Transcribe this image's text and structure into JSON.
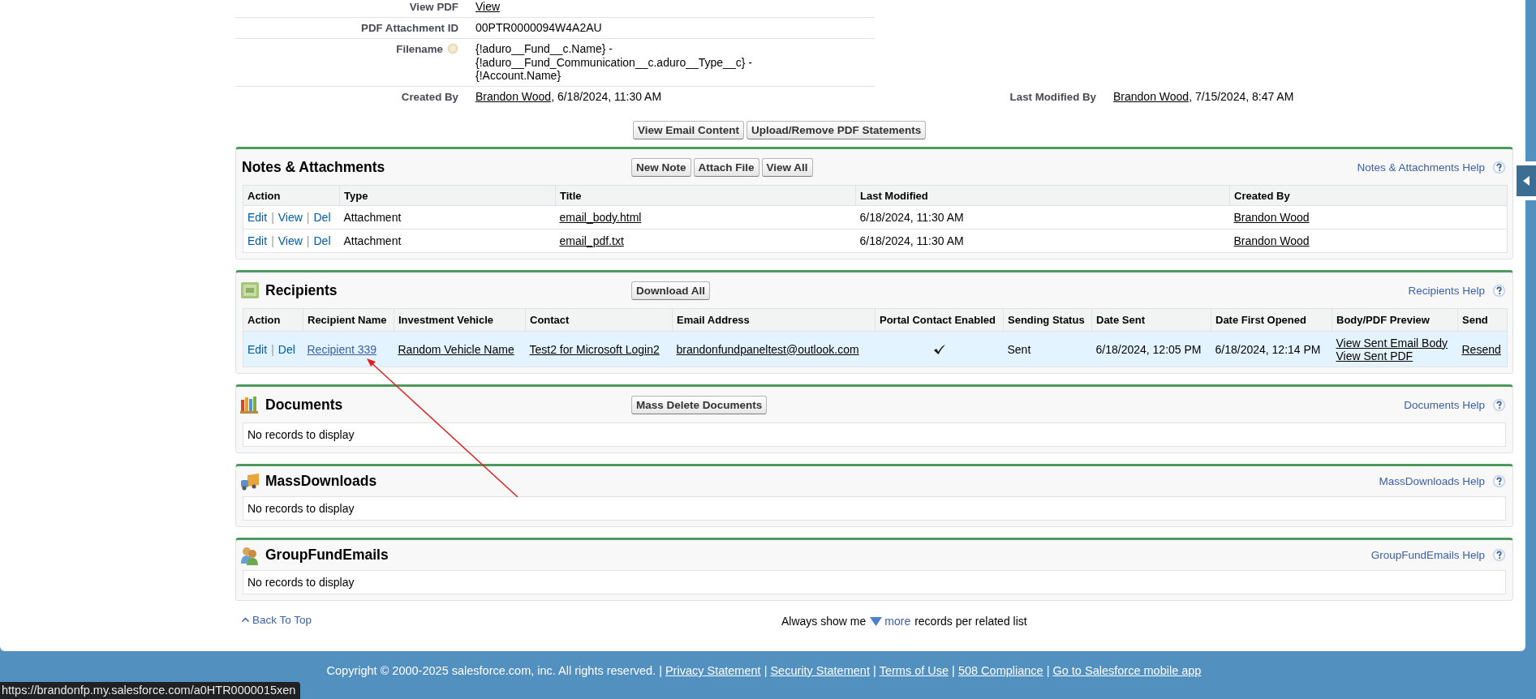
{
  "detail": {
    "rows": [
      {
        "label": "View PDF",
        "parts": [
          {
            "kind": "link",
            "text": "View"
          }
        ]
      },
      {
        "label": "PDF Attachment ID",
        "parts": [
          {
            "kind": "text",
            "text": "00PTR0000094W4A2AU"
          }
        ]
      },
      {
        "label": "Filename",
        "help": true,
        "parts": [
          {
            "kind": "text",
            "text": "{!aduro__Fund__c.Name} - {!aduro__Fund_Communication__c.aduro__Type__c} - {!Account.Name}"
          }
        ]
      },
      {
        "label": "Created By",
        "parts": [
          {
            "kind": "link",
            "text": "Brandon Wood"
          },
          {
            "kind": "text",
            "text": ", 6/18/2024, 11:30 AM"
          }
        ],
        "label_2": "Last Modified By",
        "parts_2": [
          {
            "kind": "link",
            "text": "Brandon Wood"
          },
          {
            "kind": "text",
            "text": ", 7/15/2024, 8:47 AM"
          }
        ]
      }
    ],
    "buttons": [
      "View Email Content",
      "Upload/Remove PDF Statements"
    ]
  },
  "related_lists": [
    {
      "title": "Notes & Attachments",
      "buttons": [
        "New Note",
        "Attach File",
        "View All"
      ],
      "help": "Notes & Attachments Help",
      "columns": [
        "Action",
        "Type",
        "Title",
        "Last Modified",
        "Created By"
      ],
      "rows": [
        {
          "highlighted": false,
          "cells": [
            {
              "kind": "actions",
              "links": [
                "Edit",
                "View",
                "Del"
              ],
              "separator": "|"
            },
            {
              "kind": "text",
              "text": "Attachment"
            },
            {
              "kind": "link",
              "text": "email_body.html"
            },
            {
              "kind": "text",
              "text": "6/18/2024, 11:30 AM"
            },
            {
              "kind": "link",
              "text": "Brandon Wood"
            }
          ]
        },
        {
          "highlighted": false,
          "cells": [
            {
              "kind": "actions",
              "links": [
                "Edit",
                "View",
                "Del"
              ],
              "separator": "|"
            },
            {
              "kind": "text",
              "text": "Attachment"
            },
            {
              "kind": "link",
              "text": "email_pdf.txt"
            },
            {
              "kind": "text",
              "text": "6/18/2024, 11:30 AM"
            },
            {
              "kind": "link",
              "text": "Brandon Wood"
            }
          ]
        }
      ]
    },
    {
      "title": "Recipients",
      "buttons": [
        "Download All"
      ],
      "help": "Recipients Help",
      "columns": [
        "Action",
        "Recipient Name",
        "Investment Vehicle",
        "Contact",
        "Email Address",
        "Portal Contact Enabled",
        "Sending Status",
        "Date Sent",
        "Date First Opened",
        "Body/PDF Preview",
        "Send"
      ],
      "rows": [
        {
          "highlighted": true,
          "cells": [
            {
              "kind": "actions",
              "links": [
                "Edit",
                "Del"
              ],
              "separator": "|"
            },
            {
              "kind": "blue_link",
              "text": "Recipient 339"
            },
            {
              "kind": "link",
              "text": "Random Vehicle Name"
            },
            {
              "kind": "link",
              "text": "Test2 for Microsoft Login2"
            },
            {
              "kind": "link",
              "text": "brandonfundpaneltest@outlook.com"
            },
            {
              "kind": "check",
              "checked": true
            },
            {
              "kind": "text",
              "text": "Sent"
            },
            {
              "kind": "text",
              "text": "6/18/2024, 12:05 PM"
            },
            {
              "kind": "text",
              "text": "6/18/2024, 12:14 PM"
            },
            {
              "kind": "links",
              "links": [
                "View Sent Email Body",
                "View Sent PDF"
              ]
            },
            {
              "kind": "link",
              "text": "Resend"
            }
          ]
        }
      ]
    },
    {
      "title": "Documents",
      "buttons": [
        "Mass Delete Documents"
      ],
      "help": "Documents Help",
      "empty_text": "No records to display"
    },
    {
      "title": "MassDownloads",
      "help": "MassDownloads Help",
      "empty_text": "No records to display"
    },
    {
      "title": "GroupFundEmails",
      "help": "GroupFundEmails Help",
      "empty_text": "No records to display"
    }
  ],
  "annotation": {
    "kind": "arrow"
  },
  "list_footer": {
    "back_to_top": "Back To Top",
    "before": "Always show me",
    "link": "more",
    "after": "records per related list"
  },
  "footer": {
    "copyright": "Copyright © 2000-2025 salesforce.com, inc. All rights reserved.",
    "separator": "|",
    "links": [
      "Privacy Statement",
      "Security Statement",
      "Terms of Use",
      "508 Compliance",
      "Go to Salesforce mobile app"
    ]
  },
  "status_url": "https://brandonfp.my.salesforce.com/a0HTR0000015xen"
}
